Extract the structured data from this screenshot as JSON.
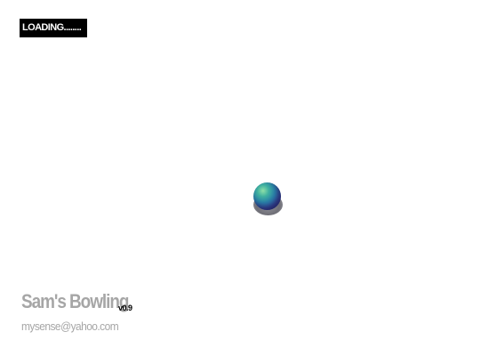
{
  "loading": {
    "label": "LOADING........"
  },
  "ball": {
    "icon": "bowling-ball-icon",
    "colors": {
      "highlight": "#8fe0a8",
      "mid": "#2a7fa8",
      "dark": "#2a2a78",
      "shadow": "#5f5f68"
    }
  },
  "footer": {
    "title": "Sam's Bowling",
    "version": "v0.9",
    "email": "mysense@yahoo.com"
  },
  "colors": {
    "background": "#ffffff",
    "loading_bg": "#000000",
    "loading_text": "#ffffff",
    "footer_text": "#a6a6a6",
    "version_text": "#000000"
  }
}
